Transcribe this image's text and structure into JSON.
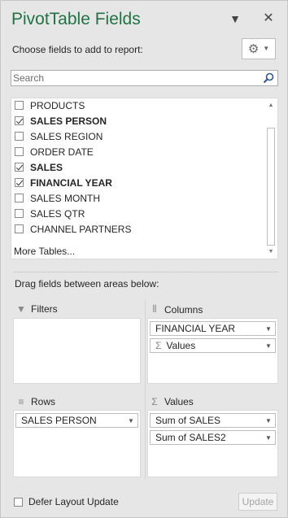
{
  "header": {
    "title": "PivotTable Fields",
    "choose_label": "Choose fields to add to report:"
  },
  "search": {
    "placeholder": "Search",
    "value": ""
  },
  "fields": [
    {
      "label": "PRODUCTS",
      "checked": false
    },
    {
      "label": "SALES PERSON",
      "checked": true
    },
    {
      "label": "SALES REGION",
      "checked": false
    },
    {
      "label": "ORDER DATE",
      "checked": false
    },
    {
      "label": "SALES",
      "checked": true
    },
    {
      "label": "FINANCIAL YEAR",
      "checked": true
    },
    {
      "label": "SALES MONTH",
      "checked": false
    },
    {
      "label": "SALES QTR",
      "checked": false
    },
    {
      "label": "CHANNEL PARTNERS",
      "checked": false
    }
  ],
  "more_tables": "More Tables...",
  "drag_hint": "Drag fields between areas below:",
  "areas": {
    "filters": {
      "label": "Filters",
      "items": []
    },
    "columns": {
      "label": "Columns",
      "items": [
        "FINANCIAL YEAR",
        "Values"
      ]
    },
    "rows": {
      "label": "Rows",
      "items": [
        "SALES PERSON"
      ]
    },
    "values": {
      "label": "Values",
      "items": [
        "Sum of SALES",
        "Sum of SALES2"
      ]
    }
  },
  "footer": {
    "defer_label": "Defer Layout Update",
    "defer_checked": false,
    "update_label": "Update"
  },
  "icons": {
    "dropdown": "chevron-down-icon",
    "close": "close-icon",
    "settings": "gear-icon",
    "search": "search-icon",
    "sigma": "sigma-icon"
  },
  "colors": {
    "title": "#217346",
    "pane_bg": "#e6e6e6"
  }
}
